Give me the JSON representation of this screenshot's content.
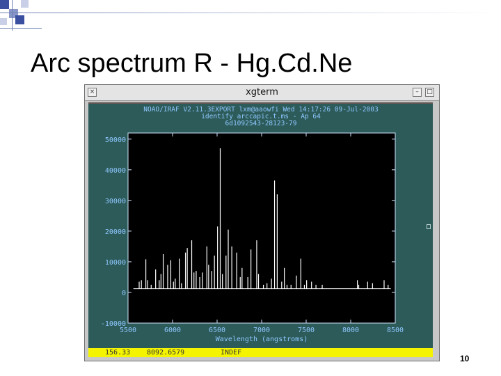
{
  "slide": {
    "title": "Arc spectrum R - Hg.Cd.Ne",
    "number": "10"
  },
  "window": {
    "title": "xgterm",
    "close_glyph": "×",
    "minimize_glyph": "–",
    "maximize_glyph": "□"
  },
  "plot": {
    "header_lines": [
      "NOAO/IRAF V2.11.3EXPORT lxm@aaowfi Wed 14:17:26 09-Jul-2003",
      "identify arccapic.t.ms - Ap 64",
      "6d1092543-28123-79"
    ]
  },
  "status_bar": {
    "pixel": "156.33",
    "wavelength": "8092.6579",
    "mode": "INDEF"
  },
  "colors": {
    "plot_background": "#000000",
    "frame_teal": "#2d5b5a",
    "text_blue": "#8fc8ff",
    "status_yellow": "#f4f400",
    "line_white": "#ffffff"
  },
  "chart_data": {
    "type": "line",
    "title": "",
    "xlabel": "Wavelength (angstroms)",
    "ylabel": "",
    "xlim": [
      5500,
      8500
    ],
    "ylim": [
      -10000,
      52000
    ],
    "x_ticks": [
      5500,
      6000,
      6500,
      7000,
      7500,
      8000,
      8500
    ],
    "x_tick_labels": [
      "5500",
      "6000",
      "6500",
      "7000",
      "7500",
      "8000",
      "8500"
    ],
    "y_ticks": [
      -10000,
      0,
      10000,
      20000,
      30000,
      40000,
      50000
    ],
    "y_tick_labels": [
      "-10000",
      "0",
      "10000",
      "20000",
      "30000",
      "40000",
      "50000"
    ],
    "grid": false,
    "series": [
      {
        "baseline": 1200,
        "lines": [
          {
            "x": 5625,
            "y": 3500
          },
          {
            "x": 5650,
            "y": 4000
          },
          {
            "x": 5700,
            "y": 10800
          },
          {
            "x": 5720,
            "y": 4000
          },
          {
            "x": 5760,
            "y": 2500
          },
          {
            "x": 5810,
            "y": 7500
          },
          {
            "x": 5850,
            "y": 4000
          },
          {
            "x": 5870,
            "y": 6000
          },
          {
            "x": 5895,
            "y": 12500
          },
          {
            "x": 5945,
            "y": 9000
          },
          {
            "x": 5980,
            "y": 10500
          },
          {
            "x": 6010,
            "y": 3500
          },
          {
            "x": 6030,
            "y": 4500
          },
          {
            "x": 6075,
            "y": 11000
          },
          {
            "x": 6100,
            "y": 3000
          },
          {
            "x": 6145,
            "y": 13000
          },
          {
            "x": 6165,
            "y": 14500
          },
          {
            "x": 6215,
            "y": 17000
          },
          {
            "x": 6240,
            "y": 6500
          },
          {
            "x": 6265,
            "y": 7000
          },
          {
            "x": 6305,
            "y": 5000
          },
          {
            "x": 6335,
            "y": 6500
          },
          {
            "x": 6385,
            "y": 15000
          },
          {
            "x": 6405,
            "y": 9000
          },
          {
            "x": 6440,
            "y": 7000
          },
          {
            "x": 6470,
            "y": 12000
          },
          {
            "x": 6505,
            "y": 21500
          },
          {
            "x": 6535,
            "y": 47000
          },
          {
            "x": 6560,
            "y": 6000
          },
          {
            "x": 6600,
            "y": 12000
          },
          {
            "x": 6625,
            "y": 20500
          },
          {
            "x": 6665,
            "y": 15000
          },
          {
            "x": 6720,
            "y": 13000
          },
          {
            "x": 6760,
            "y": 5000
          },
          {
            "x": 6780,
            "y": 8000
          },
          {
            "x": 6845,
            "y": 5000
          },
          {
            "x": 6880,
            "y": 14000
          },
          {
            "x": 6945,
            "y": 17000
          },
          {
            "x": 6965,
            "y": 6000
          },
          {
            "x": 7020,
            "y": 2500
          },
          {
            "x": 7060,
            "y": 3000
          },
          {
            "x": 7110,
            "y": 4500
          },
          {
            "x": 7145,
            "y": 36500
          },
          {
            "x": 7175,
            "y": 32000
          },
          {
            "x": 7225,
            "y": 3500
          },
          {
            "x": 7255,
            "y": 8000
          },
          {
            "x": 7285,
            "y": 2500
          },
          {
            "x": 7330,
            "y": 2500
          },
          {
            "x": 7390,
            "y": 5500
          },
          {
            "x": 7440,
            "y": 11000
          },
          {
            "x": 7480,
            "y": 2500
          },
          {
            "x": 7505,
            "y": 4000
          },
          {
            "x": 7560,
            "y": 3500
          },
          {
            "x": 7610,
            "y": 2500
          },
          {
            "x": 7680,
            "y": 2500
          },
          {
            "x": 8075,
            "y": 4000
          },
          {
            "x": 8090,
            "y": 2500
          },
          {
            "x": 8190,
            "y": 3500
          },
          {
            "x": 8245,
            "y": 3000
          },
          {
            "x": 8375,
            "y": 4000
          },
          {
            "x": 8420,
            "y": 2500
          }
        ]
      }
    ]
  }
}
